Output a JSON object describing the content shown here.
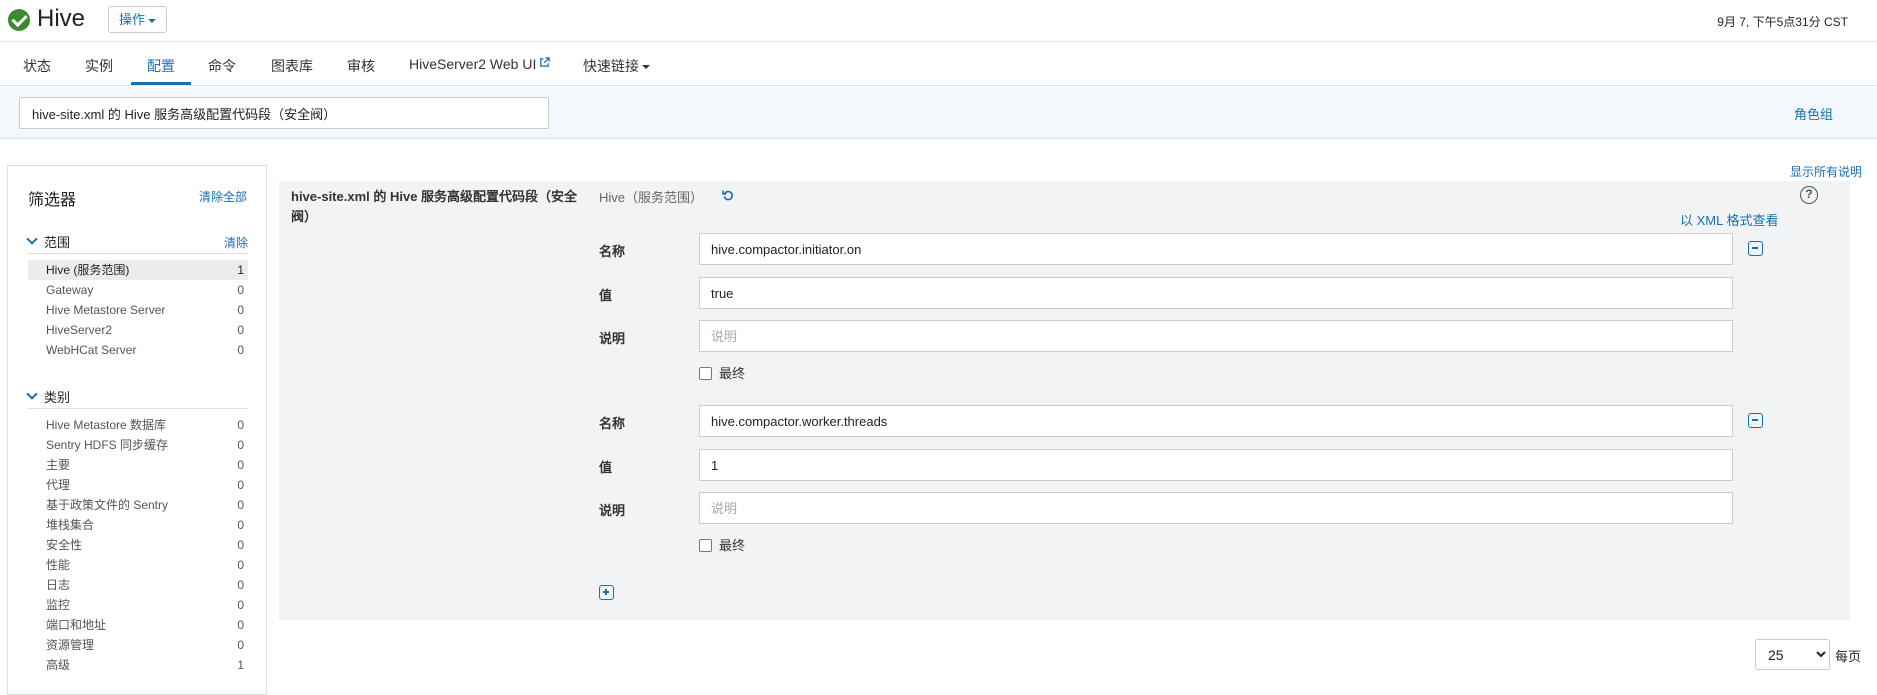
{
  "header": {
    "title": "Hive",
    "actions_label": "操作",
    "timestamp": "9月 7, 下午5点31分 CST",
    "status_color": "#3a8a2e"
  },
  "tabs": [
    {
      "label": "状态"
    },
    {
      "label": "实例"
    },
    {
      "label": "配置",
      "active": true
    },
    {
      "label": "命令"
    },
    {
      "label": "图表库"
    },
    {
      "label": "审核"
    },
    {
      "label": "HiveServer2 Web UI"
    },
    {
      "label": "快速链接"
    }
  ],
  "search": {
    "value": "hive-site.xml 的 Hive 服务高级配置代码段（安全阀）"
  },
  "role_group_label": "角色组",
  "show_all_descriptions": "显示所有说明",
  "sidebar": {
    "title": "筛选器",
    "clear_all": "清除全部",
    "scope": {
      "label": "范围",
      "clear": "清除",
      "items": [
        {
          "name": "Hive (服务范围)",
          "count": "1"
        },
        {
          "name": "Gateway",
          "count": "0"
        },
        {
          "name": "Hive Metastore Server",
          "count": "0"
        },
        {
          "name": "HiveServer2",
          "count": "0"
        },
        {
          "name": "WebHCat Server",
          "count": "0"
        }
      ]
    },
    "category": {
      "label": "类别",
      "items": [
        {
          "name": "Hive Metastore 数据库",
          "count": "0"
        },
        {
          "name": "Sentry HDFS 同步缓存",
          "count": "0"
        },
        {
          "name": "主要",
          "count": "0"
        },
        {
          "name": "代理",
          "count": "0"
        },
        {
          "name": "基于政策文件的 Sentry",
          "count": "0"
        },
        {
          "name": "堆栈集合",
          "count": "0"
        },
        {
          "name": "安全性",
          "count": "0"
        },
        {
          "name": "性能",
          "count": "0"
        },
        {
          "name": "日志",
          "count": "0"
        },
        {
          "name": "监控",
          "count": "0"
        },
        {
          "name": "端口和地址",
          "count": "0"
        },
        {
          "name": "资源管理",
          "count": "0"
        },
        {
          "name": "高级",
          "count": "1"
        }
      ]
    }
  },
  "property": {
    "title": "hive-site.xml 的 Hive 服务高级配置代码段（安全阀）",
    "scope": "Hive（服务范围）",
    "xml_link": "以 XML 格式查看",
    "help": "?",
    "entries": [
      {
        "name_label": "名称",
        "name_value": "hive.compactor.initiator.on",
        "value_label": "值",
        "value_value": "true",
        "desc_label": "说明",
        "desc_placeholder": "说明",
        "final_label": "最终"
      },
      {
        "name_label": "名称",
        "name_value": "hive.compactor.worker.threads",
        "value_label": "值",
        "value_value": "1",
        "desc_label": "说明",
        "desc_placeholder": "说明",
        "final_label": "最终"
      }
    ]
  },
  "pager": {
    "per_page": "25",
    "per_page_label": "每页"
  },
  "colors": {
    "accent": "#1a6fad",
    "panel_bg": "#f2f3f5",
    "band_bg": "#f3f8fc"
  }
}
